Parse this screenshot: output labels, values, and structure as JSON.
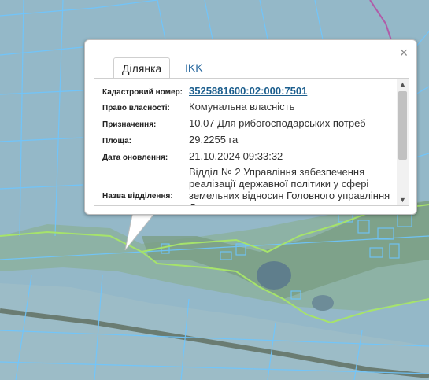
{
  "popup": {
    "tabs": [
      {
        "label": "Ділянка",
        "active": true
      },
      {
        "label": "IKK",
        "active": false
      }
    ],
    "close_symbol": "×",
    "fields": [
      {
        "label": "Кадастровий номер:",
        "value": "3525881600:02:000:7501",
        "link": true
      },
      {
        "label": "Право власності:",
        "value": "Комунальна власність"
      },
      {
        "label": "Призначення:",
        "value": "10.07 Для рибогосподарських потреб"
      },
      {
        "label": "Площа:",
        "value": "29.2255 га"
      },
      {
        "label": "Дата оновлення:",
        "value": "21.10.2024 09:33:32"
      },
      {
        "label": "Назва відділення:",
        "value": "Відділ № 2 Управління забезпечення реалізації державної політики у сфері земельних відносин Головного управління Держгеокадастру"
      }
    ]
  },
  "colors": {
    "map_overlay": "#9ec3d6",
    "parcel_border": "#6ec6ff",
    "boundary_green": "#a6e36b",
    "link": "#1d5f8e",
    "road_magenta": "#b05ca8"
  }
}
